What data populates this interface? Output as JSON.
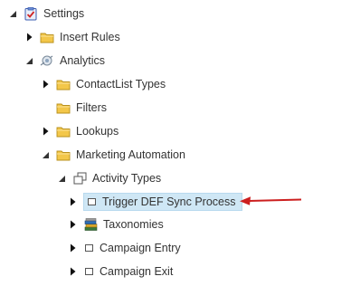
{
  "tree": {
    "settings": {
      "label": "Settings",
      "icon": "settings-checklist-icon",
      "expanded": true
    },
    "insert_rules": {
      "label": "Insert Rules",
      "icon": "folder-icon",
      "expanded": false
    },
    "analytics": {
      "label": "Analytics",
      "icon": "analytics-icon",
      "expanded": true
    },
    "contactlist_types": {
      "label": "ContactList Types",
      "icon": "folder-icon",
      "expanded": false
    },
    "filters": {
      "label": "Filters",
      "icon": "folder-icon"
    },
    "lookups": {
      "label": "Lookups",
      "icon": "folder-icon",
      "expanded": false
    },
    "marketing_automation": {
      "label": "Marketing Automation",
      "icon": "folder-icon",
      "expanded": true
    },
    "activity_types": {
      "label": "Activity Types",
      "icon": "template-icon",
      "expanded": true
    },
    "trigger_def_sync": {
      "label": "Trigger DEF Sync Process",
      "icon": "item-icon",
      "expanded": false,
      "selected": true
    },
    "taxonomies": {
      "label": "Taxonomies",
      "icon": "books-icon",
      "expanded": false
    },
    "campaign_entry": {
      "label": "Campaign Entry",
      "icon": "item-icon",
      "expanded": false
    },
    "campaign_exit": {
      "label": "Campaign Exit",
      "icon": "item-icon",
      "expanded": false
    }
  },
  "colors": {
    "selection_bg": "#cfe7f5",
    "selection_border": "#b8d9ee",
    "annotation_arrow": "#cc1f1f",
    "folder_yellow": "#f3c74a",
    "text": "#333333"
  }
}
